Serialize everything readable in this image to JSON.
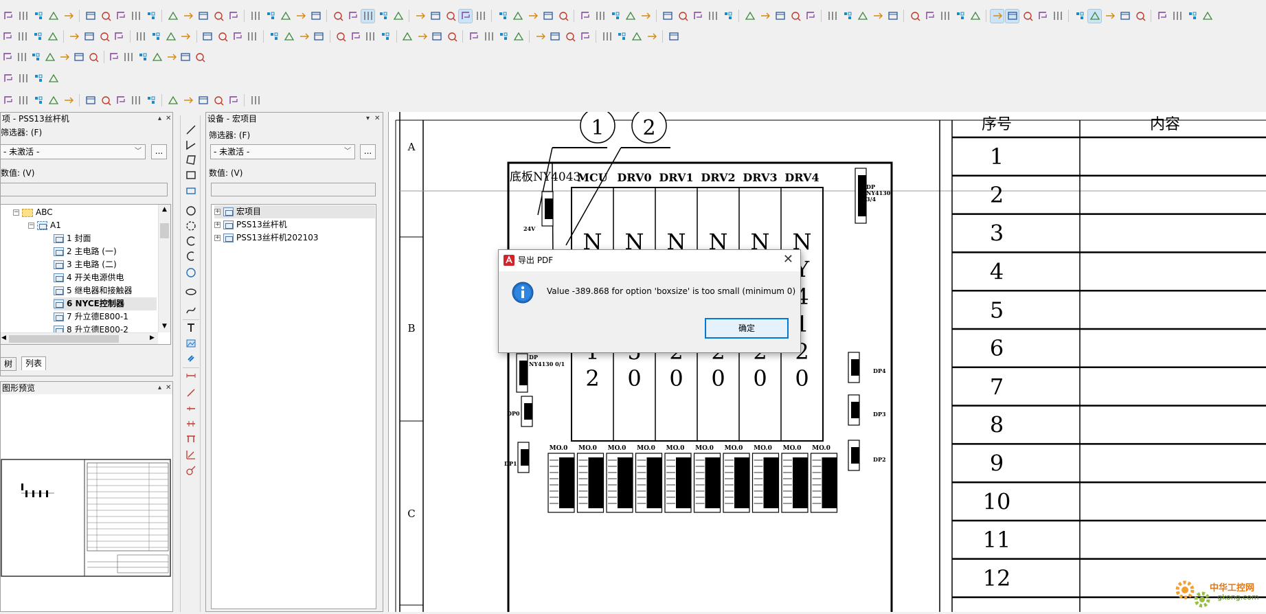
{
  "left_panel": {
    "title": "项 - PSS13丝杆机",
    "filter_label": "筛选器: (F)",
    "filter_value": "- 未激活 -",
    "filter_button": "...",
    "value_label": "数值: (V)",
    "tree": [
      {
        "label": "ABC",
        "level": 1
      },
      {
        "label": "A1",
        "level": 2
      },
      {
        "label": "1 封面",
        "level": 3
      },
      {
        "label": "2 主电路 (一)",
        "level": 3
      },
      {
        "label": "3 主电路 (二)",
        "level": 3
      },
      {
        "label": "4 开关电源供电",
        "level": 3
      },
      {
        "label": "5 继电器和接触器",
        "level": 3
      },
      {
        "label": "6 NYCE控制器",
        "level": 3
      },
      {
        "label": "7 升立德E800-1",
        "level": 3
      },
      {
        "label": "8 升立德E800-2",
        "level": 3
      }
    ],
    "tabs": [
      "树",
      "列表"
    ]
  },
  "preview_panel": {
    "title": "图形预览"
  },
  "right_panel": {
    "title": "设备 - 宏项目",
    "filter_label": "筛选器: (F)",
    "filter_value": "- 未激活 -",
    "filter_button": "...",
    "value_label": "数值: (V)",
    "tree": [
      {
        "label": "宏项目"
      },
      {
        "label": "PSS13丝杆机"
      },
      {
        "label": "PSS13丝杆机202103"
      }
    ]
  },
  "drawing": {
    "col_numbers": [
      "1",
      "2"
    ],
    "row_letters": [
      "A",
      "B",
      "C"
    ],
    "board_label": "底板NY4043",
    "slot_headers": [
      "MCU",
      "DRV0",
      "DRV1",
      "DRV2",
      "DRV3",
      "DRV4"
    ],
    "slot_tail_digits": [
      "2",
      "0",
      "0",
      "0",
      "0",
      "0"
    ],
    "slot_mid_digits": [
      "1",
      "5",
      "2",
      "2",
      "2",
      "2"
    ],
    "dp_labels": [
      "DP NY4130 3/4",
      "DP NY4130 0/1",
      "DP0",
      "DP1",
      "DP2",
      "DP3",
      "DP4"
    ],
    "mo_label": "MO.0",
    "table_header": [
      "序号",
      "内容"
    ],
    "table_rows": [
      "1",
      "2",
      "3",
      "4",
      "5",
      "6",
      "7",
      "8",
      "9",
      "10",
      "11",
      "12"
    ]
  },
  "dialog": {
    "title": "导出 PDF",
    "message": "Value -389.868 for option 'boxsize' is too small (minimum 0)",
    "ok_label": "确定"
  },
  "watermark": {
    "text": "中华工控网",
    "url": "gkong.com"
  }
}
